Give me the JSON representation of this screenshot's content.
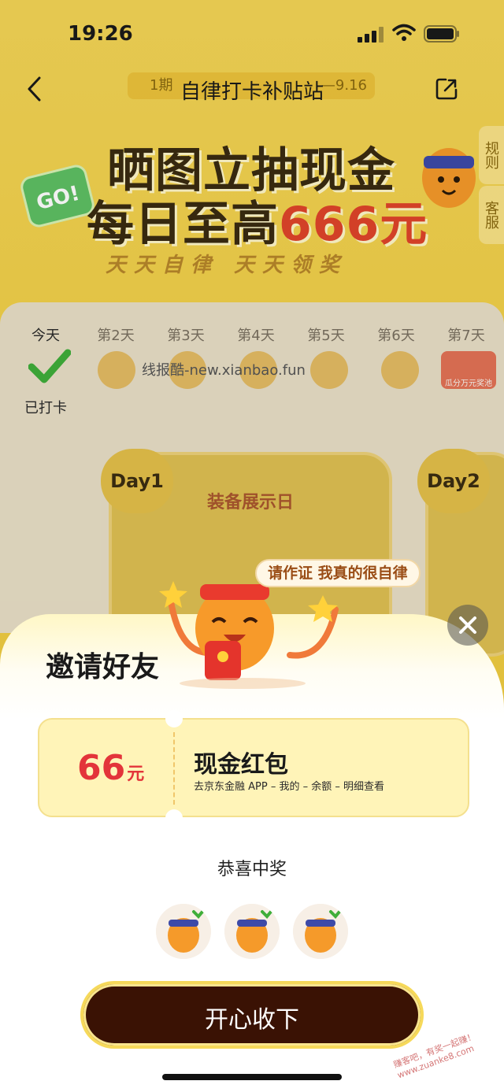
{
  "status_bar": {
    "time": "19:26"
  },
  "nav": {
    "title": "自律打卡补贴站",
    "period_left": "1期",
    "period_right": "—9.16"
  },
  "side_tabs": {
    "rules": "规则",
    "service": "客服"
  },
  "banner": {
    "line1": "晒图立抽现金",
    "line2_prefix": "每日至高",
    "line2_highlight": "666元",
    "subtitle": "天天自律 天天领奖",
    "go_badge": "GO!"
  },
  "checkin": {
    "days": [
      "今天",
      "第2天",
      "第3天",
      "第4天",
      "第5天",
      "第6天",
      "第7天"
    ],
    "checked_text": "已打卡",
    "day7_label": "瓜分万元奖池",
    "watermark": "线报酷-new.xianbao.fun"
  },
  "day_cards": {
    "day1_badge": "Day1",
    "day1_title": "装备展示日",
    "day2_badge": "Day2"
  },
  "modal": {
    "title": "邀请好友",
    "speech": "请作证 我真的很自律",
    "coupon": {
      "amount": "66",
      "unit": "元",
      "title": "现金红包",
      "desc": "去京东金融 APP – 我的 – 余额 – 明细查看"
    },
    "congrats": "恭喜中奖",
    "accept_button": "开心收下"
  },
  "corner_watermark": "赚客吧，有奖一起赚！ www.zuanke8.com",
  "colors": {
    "accent_red": "#e3343a",
    "button_bg": "#3a1204",
    "button_border": "#f6d95a",
    "page_yellow": "#f2d24a"
  }
}
